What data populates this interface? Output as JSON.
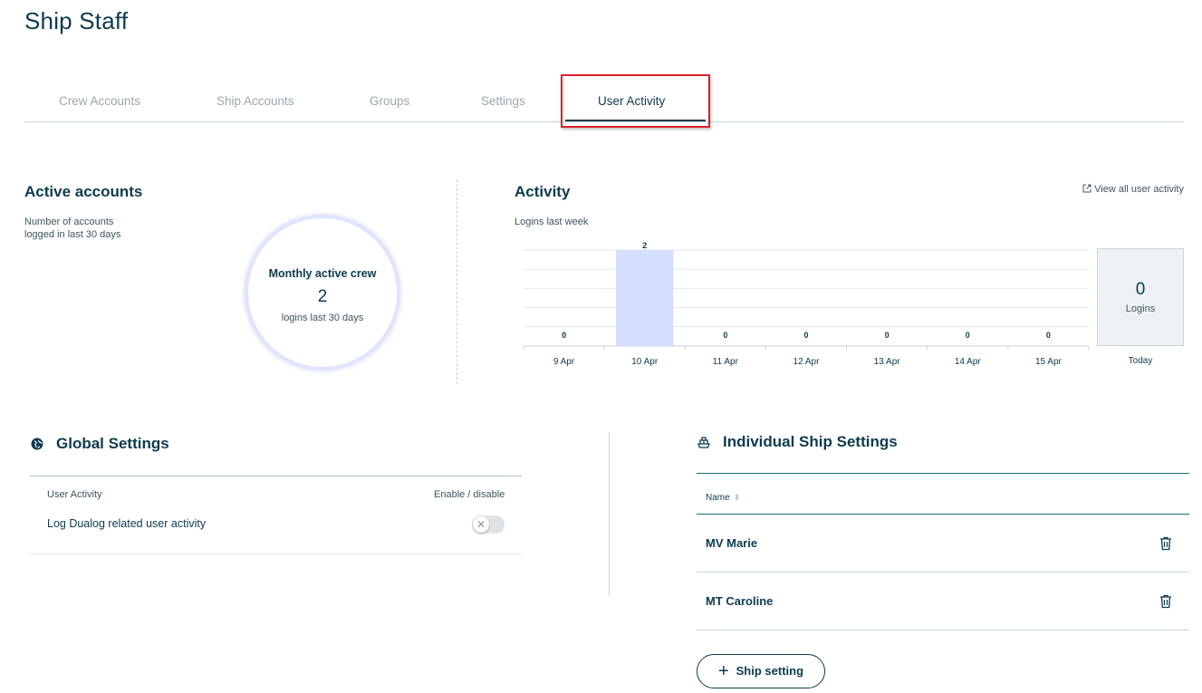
{
  "page": {
    "title": "Ship Staff"
  },
  "tabs": [
    {
      "label": "Crew Accounts"
    },
    {
      "label": "Ship Accounts"
    },
    {
      "label": "Groups"
    },
    {
      "label": "Settings"
    },
    {
      "label": "User Activity",
      "active": true
    }
  ],
  "active_accounts": {
    "title": "Active accounts",
    "description_line1": "Number of accounts",
    "description_line2": "logged in last 30 days",
    "circle_title": "Monthly active crew",
    "circle_value": "2",
    "circle_subtitle": "logins last 30 days"
  },
  "activity": {
    "title": "Activity",
    "subtitle": "Logins last week",
    "view_all_label": "View all user activity",
    "today": {
      "value": "0",
      "label": "Logins",
      "axis_label": "Today"
    }
  },
  "chart_data": {
    "type": "bar",
    "categories": [
      "9 Apr",
      "10 Apr",
      "11 Apr",
      "12 Apr",
      "13 Apr",
      "14 Apr",
      "15 Apr"
    ],
    "values": [
      0,
      2,
      0,
      0,
      0,
      0,
      0
    ],
    "ylim": [
      0,
      2
    ],
    "grid": true,
    "bar_color": "#d4deff"
  },
  "global_settings": {
    "title": "Global Settings",
    "header_left": "User Activity",
    "header_right": "Enable / disable",
    "row_label": "Log Dualog related user activity",
    "toggle_enabled": false
  },
  "ship_settings": {
    "title": "Individual Ship Settings",
    "column_name": "Name",
    "rows": [
      {
        "name": "MV Marie"
      },
      {
        "name": "MT Caroline"
      }
    ],
    "add_button_label": "Ship setting"
  },
  "colors": {
    "primary": "#0d3b4f",
    "highlight_border": "#d8232a",
    "bar": "#d4deff"
  }
}
